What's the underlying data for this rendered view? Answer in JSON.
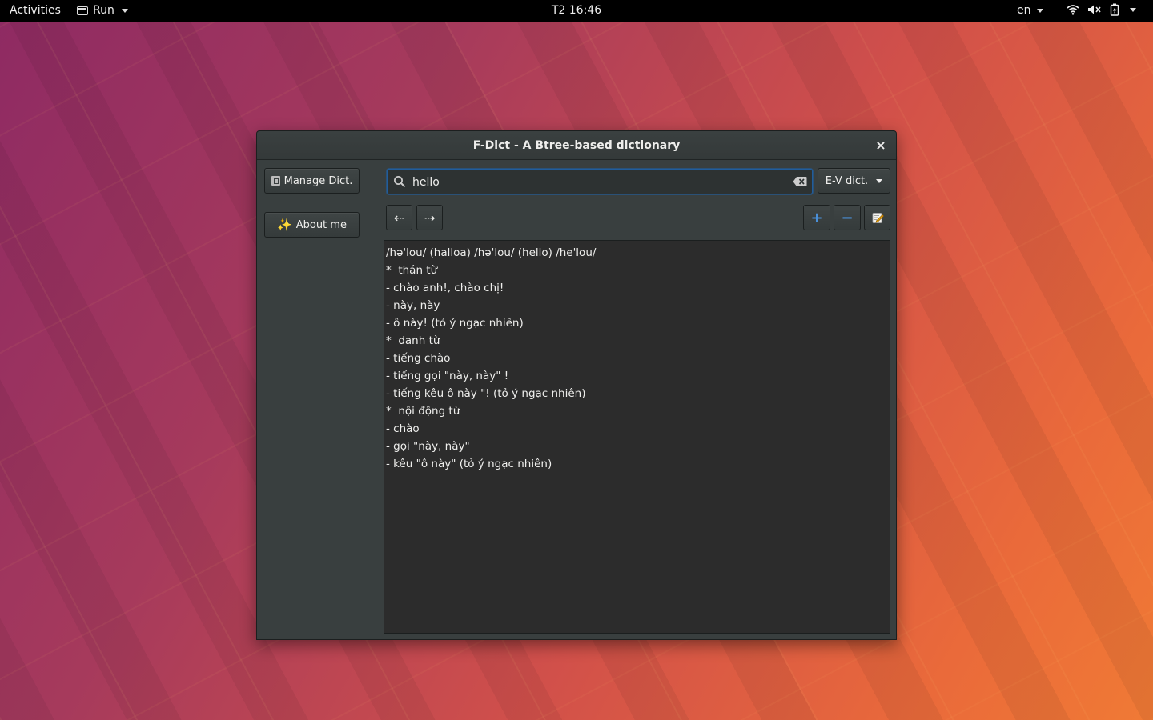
{
  "topbar": {
    "activities": "Activities",
    "app_menu": "Run",
    "clock": "T2 16:46",
    "language": "en"
  },
  "window": {
    "title": "F-Dict - A Btree-based dictionary",
    "close": "×"
  },
  "sidebar": {
    "manage_label": "Manage Dict.",
    "about_label": "About me",
    "about_icon": "✨"
  },
  "search": {
    "query": "hello"
  },
  "dict_selector": {
    "selected": "E-V dict."
  },
  "toolbar": {
    "back_glyph": "⇠",
    "forward_glyph": "⇢",
    "add_glyph": "+",
    "remove_glyph": "−"
  },
  "definition": {
    "lines": [
      "/hə'lou/ (halloa) /hə'lou/ (hello) /he'lou/",
      "*  thán từ",
      "- chào anh!, chào chị!",
      "- này, này",
      "- ô này! (tỏ ý ngạc nhiên)",
      "*  danh từ",
      "- tiếng chào",
      "- tiếng gọi \"này, này\" !",
      "- tiếng kêu ô này \"! (tỏ ý ngạc nhiên)",
      "*  nội động từ",
      "- chào",
      "- gọi \"này, này\"",
      "- kêu \"ô này\" (tỏ ý ngạc nhiên)"
    ]
  },
  "colors": {
    "accent": "#215d9c",
    "window_bg": "#393f3f",
    "text_view_bg": "#2c2c2c",
    "add_icon": "#4a90d9"
  }
}
